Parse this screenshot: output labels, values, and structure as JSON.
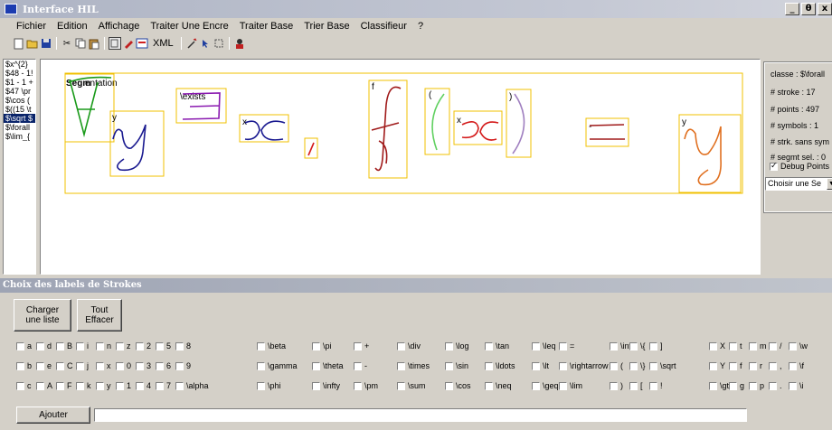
{
  "window": {
    "title": "Interface HIL",
    "buttons": [
      "_",
      "θ",
      "x"
    ]
  },
  "menu": [
    "Fichier",
    "Edition",
    "Affichage",
    "Traiter Une Encre",
    "Traiter Base",
    "Trier Base",
    "Classifieur",
    "?"
  ],
  "toolbar": {
    "xml_label": "XML"
  },
  "left_list": {
    "items": [
      "$x^{2}",
      "$48 - 1!",
      "$1 - 1 +",
      "$47 \\pr",
      "$\\cos (",
      "$((15 \\t",
      "$\\sqrt $",
      "$\\forall",
      "$\\lim_{"
    ],
    "selected_index": 6
  },
  "canvas": {
    "overlay_text_1": "Segm",
    "overlay_text_2": "entation",
    "box_labels": [
      "y",
      "\\exists",
      "x",
      "f",
      "(",
      "x",
      ")",
      "-",
      "y"
    ],
    "colors": {
      "box": "#f0c000",
      "green": "#1a9a1a",
      "navy": "#1a1a90",
      "purple": "#8a1ab0",
      "red": "#d41a1a",
      "darkred": "#a01a1a",
      "lightgreen": "#60d060",
      "lavender": "#a080c0",
      "orange": "#e07020"
    }
  },
  "right_panel": {
    "classe": "classe : $\\forall",
    "stroke": "# stroke : 17",
    "points": "# points : 497",
    "symbols": "# symbols : 1",
    "strk_sans": "# strk. sans sym",
    "segmt_sel": "# segmt sel. : 0",
    "debug_points": "Debug Points",
    "select_value": "Choisir une Se"
  },
  "bottom": {
    "title": "Choix des labels de Strokes",
    "charger_line1": "Charger",
    "charger_line2": "une liste",
    "tout_line1": "Tout",
    "tout_line2": "Effacer",
    "ajouter": "Ajouter",
    "labels": [
      [
        "a",
        "d",
        "B",
        "i",
        "n",
        "z",
        "2",
        "5",
        "8",
        "\\beta",
        "\\pi",
        "+",
        "\\div",
        "\\log",
        "\\tan",
        "\\leq",
        "=",
        "\\int",
        "\\{",
        "]",
        "X",
        "t",
        "m",
        "/",
        "\\w"
      ],
      [
        "b",
        "e",
        "C",
        "j",
        "x",
        "0",
        "3",
        "6",
        "9",
        "\\gamma",
        "\\theta",
        "-",
        "\\times",
        "\\sin",
        "\\ldots",
        "\\lt",
        "\\rightarrow",
        "(",
        "\\}",
        "\\sqrt",
        "Y",
        "f",
        "r",
        ",",
        "\\f"
      ],
      [
        "c",
        "A",
        "F",
        "k",
        "y",
        "1",
        "4",
        "7",
        "\\alpha",
        "\\phi",
        "\\infty",
        "\\pm",
        "\\sum",
        "\\cos",
        "\\neq",
        "\\geq",
        "\\lim",
        ")",
        "[",
        "!",
        "\\gt",
        "g",
        "p",
        ".",
        "\\i"
      ]
    ]
  }
}
